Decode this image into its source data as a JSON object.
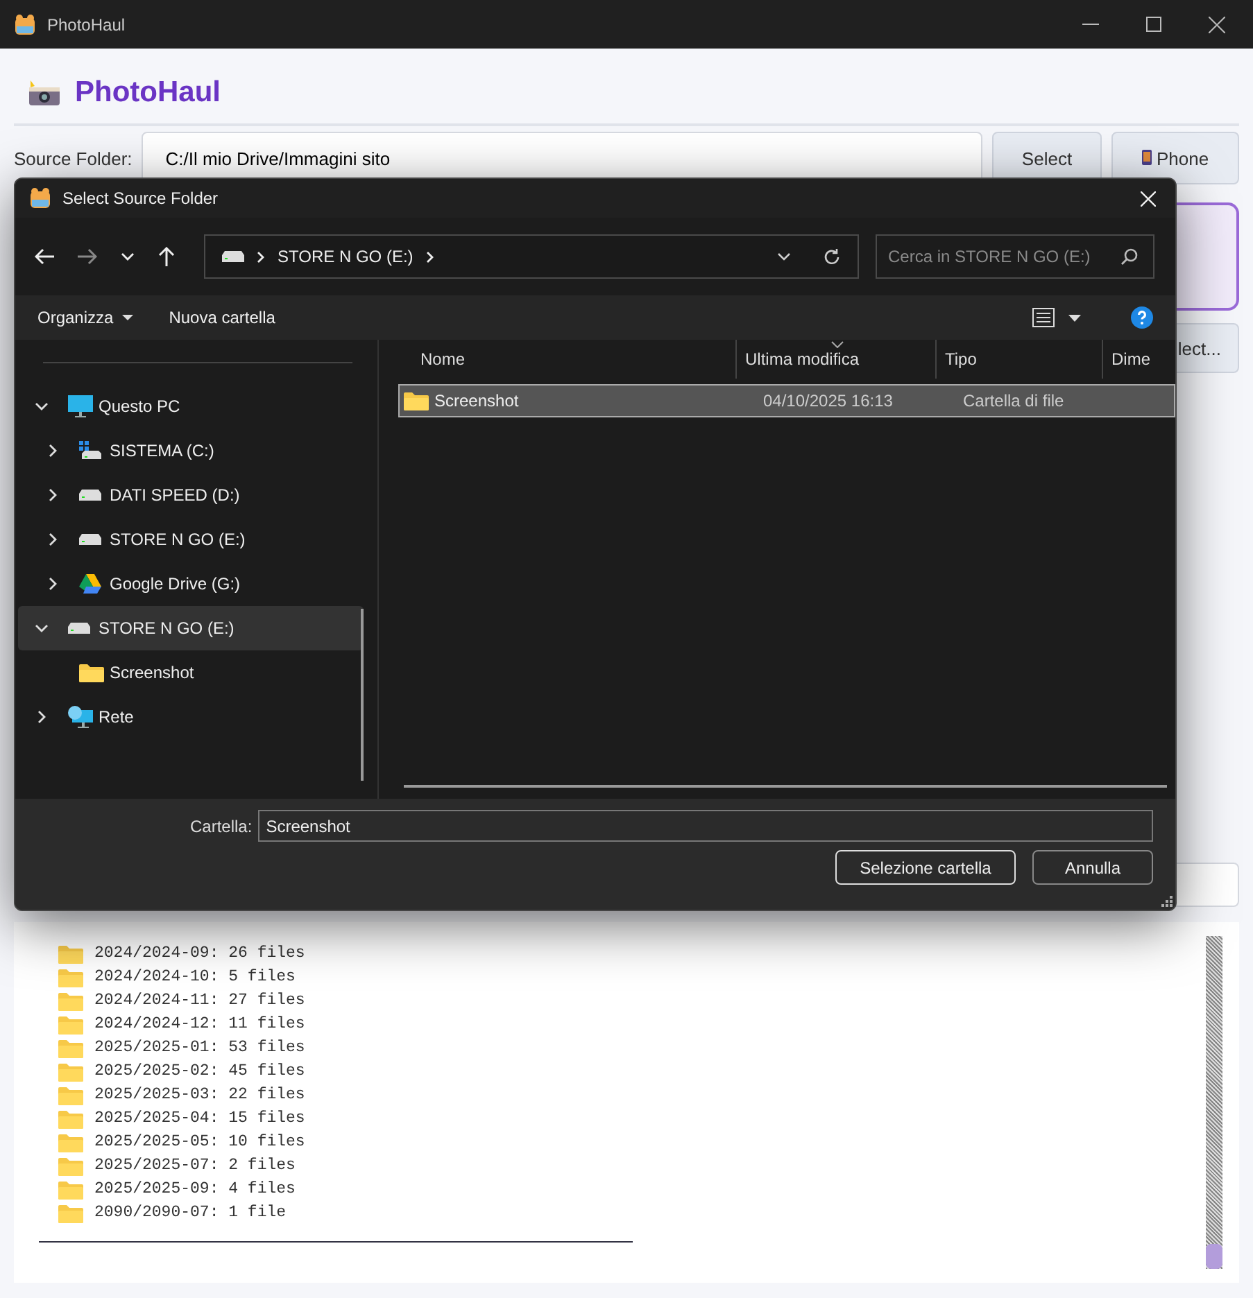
{
  "window": {
    "title": "PhotoHaul"
  },
  "app": {
    "title": "PhotoHaul",
    "source_label": "Source Folder:",
    "source_value": "C:/Il mio Drive/Immagini sito",
    "select_button": "Select",
    "phone_button": "Phone",
    "partial_button": "lect...",
    "log": [
      "2024/2024-09: 26 files",
      "2024/2024-10: 5 files",
      "2024/2024-11: 27 files",
      "2024/2024-12: 11 files",
      "2025/2025-01: 53 files",
      "2025/2025-02: 45 files",
      "2025/2025-03: 22 files",
      "2025/2025-04: 15 files",
      "2025/2025-05: 10 files",
      "2025/2025-07: 2 files",
      "2025/2025-09: 4 files",
      "2090/2090-07: 1 file"
    ]
  },
  "dialog": {
    "title": "Select Source Folder",
    "address": [
      "STORE N GO (E:)"
    ],
    "search": {
      "placeholder": "Cerca in STORE N GO (E:)"
    },
    "commands": [
      {
        "label": "Organizza",
        "menu": true
      },
      {
        "label": "Nuova cartella",
        "menu": false
      }
    ],
    "tree": [
      {
        "label": "Questo PC",
        "kind": "pc",
        "expanded": true,
        "selected": false,
        "children": [
          {
            "label": "SISTEMA (C:)",
            "kind": "system",
            "expanded": false,
            "selected": false
          },
          {
            "label": "DATI SPEED (D:)",
            "kind": "drive",
            "expanded": false,
            "selected": false
          },
          {
            "label": "STORE N GO (E:)",
            "kind": "drive",
            "expanded": false,
            "selected": false
          },
          {
            "label": "Google Drive (G:)",
            "kind": "cloud",
            "expanded": false,
            "selected": false
          }
        ]
      },
      {
        "label": "STORE N GO (E:)",
        "kind": "drive",
        "expanded": true,
        "selected": true,
        "children": [
          {
            "label": "Screenshot",
            "kind": "folder",
            "selected": false
          }
        ]
      },
      {
        "label": "Rete",
        "kind": "network",
        "expanded": false,
        "selected": false
      }
    ],
    "columns": [
      {
        "label": "Nome",
        "sorted": false
      },
      {
        "label": "Ultima modifica",
        "sorted": true
      },
      {
        "label": "Tipo",
        "sorted": false
      },
      {
        "label": "Dime",
        "sorted": false
      }
    ],
    "rows": [
      {
        "name": "Screenshot",
        "modified": "04/10/2025 16:13",
        "type": "Cartella di file",
        "selected": true
      }
    ],
    "folder_label": "Cartella:",
    "folder_value": "Screenshot",
    "buttons": [
      "Selezione cartella",
      "Annulla"
    ]
  }
}
